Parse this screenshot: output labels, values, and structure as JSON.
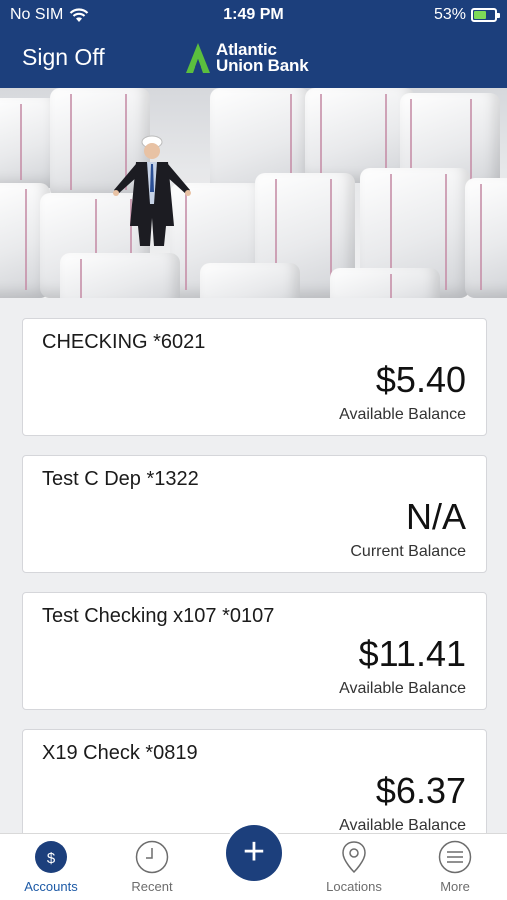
{
  "status_bar": {
    "carrier": "No SIM",
    "time": "1:49 PM",
    "battery": "53%",
    "battery_level": 0.53
  },
  "header": {
    "sign_off": "Sign Off",
    "logo": "Atlantic Union Bank",
    "logo_line1": "Atlantic",
    "logo_line2": "Union Bank"
  },
  "accounts": [
    {
      "name": "CHECKING *6021",
      "amount": "$5.40",
      "label": "Available Balance"
    },
    {
      "name": "Test C Dep *1322",
      "amount": "N/A",
      "label": "Current Balance"
    },
    {
      "name": "Test Checking x107 *0107",
      "amount": "$11.41",
      "label": "Available Balance"
    },
    {
      "name": "X19 Check *0819",
      "amount": "$6.37",
      "label": "Available Balance"
    }
  ],
  "tabbar": {
    "accounts": "Accounts",
    "recent": "Recent",
    "add": "+",
    "locations": "Locations",
    "more": "More"
  },
  "colors": {
    "header": "#1c3f7c",
    "active_tab": "#1d5aa6",
    "logo_green": "#5bbf3e"
  }
}
